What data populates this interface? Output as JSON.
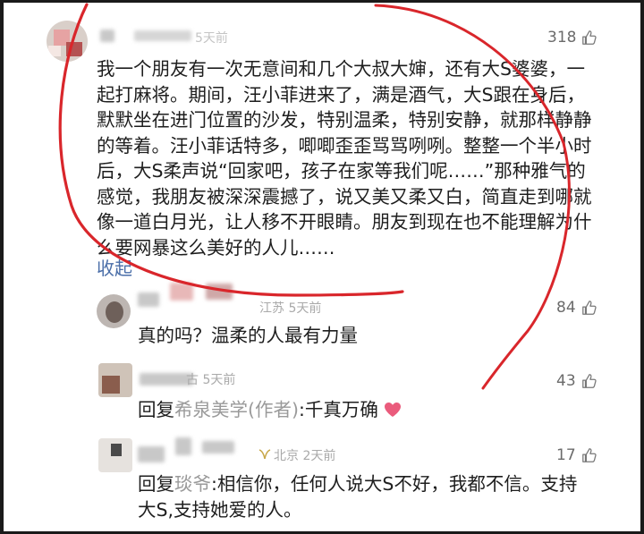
{
  "main_comment": {
    "time": "5天前",
    "likes": "318",
    "text": "我一个朋友有一次无意间和几个大叔大婶，还有大S婆婆，一起打麻将。期间，汪小菲进来了，满是酒气，大S跟在身后，默默坐在进门位置的沙发，特别温柔，特别安静，就那样静静的等着。汪小菲话特多，唧唧歪歪骂骂咧咧。整整一个半小时后，大S柔声说“回家吧，孩子在家等我们呢……”那种雅气的感觉，我朋友被深深震撼了，说又美又柔又白，简直走到哪就像一道白月光，让人移不开眼睛。朋友到现在也不能理解为什么要网暴这么美好的人儿……",
    "collapse": "收起"
  },
  "replies": [
    {
      "location": "江苏",
      "time": "5天前",
      "likes": "84",
      "text": "真的吗？温柔的人最有力量"
    },
    {
      "location": "古",
      "time": "5天前",
      "likes": "43",
      "prefix": "回复",
      "target": "希泉美学(作者)",
      "text": ":千真万确"
    },
    {
      "location": "北京",
      "time": "2天前",
      "likes": "17",
      "prefix": "回复",
      "target": "琰爷",
      "text": ":相信你，任何人说大S不好，我都不信。支持大S,支持她爱的人。"
    }
  ],
  "icons": {
    "like": "thumbs-up-icon",
    "heart": "heart-icon",
    "location": "location-icon"
  },
  "colors": {
    "ink_annotation": "#d9262b",
    "link": "#4a6ea8",
    "meta": "#a9a9a9"
  }
}
